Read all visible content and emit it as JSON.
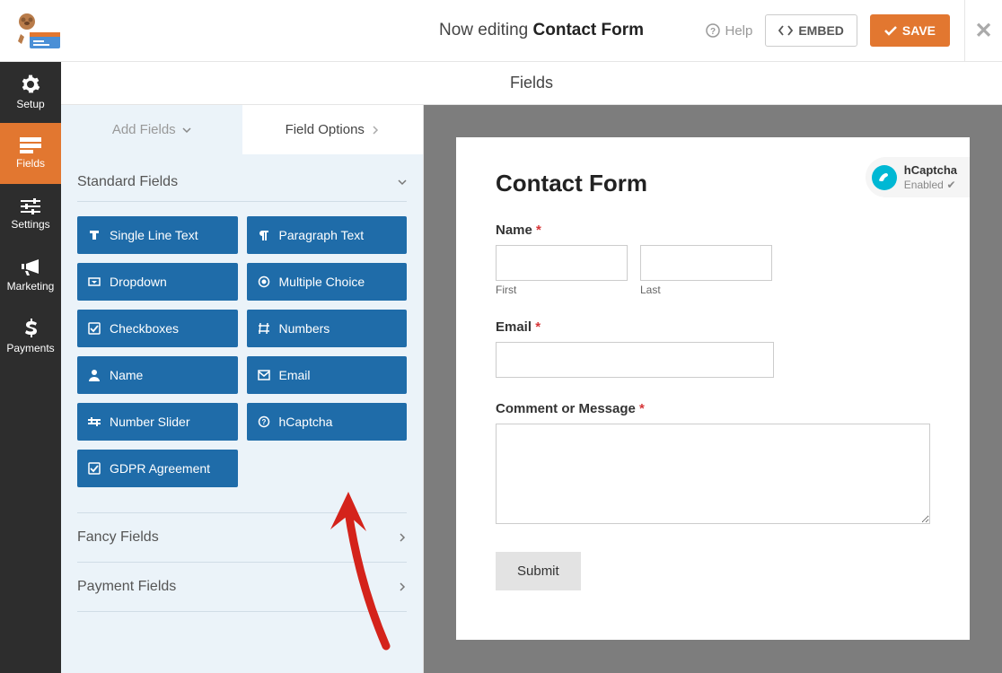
{
  "header": {
    "editing_prefix": "Now editing ",
    "editing_title": "Contact Form",
    "help": "Help",
    "embed": "EMBED",
    "save": "SAVE"
  },
  "sidenav": {
    "items": [
      {
        "label": "Setup"
      },
      {
        "label": "Fields"
      },
      {
        "label": "Settings"
      },
      {
        "label": "Marketing"
      },
      {
        "label": "Payments"
      }
    ]
  },
  "section_header": "Fields",
  "tabs": {
    "add": "Add Fields",
    "options": "Field Options"
  },
  "standard": {
    "title": "Standard Fields",
    "fields": [
      "Single Line Text",
      "Paragraph Text",
      "Dropdown",
      "Multiple Choice",
      "Checkboxes",
      "Numbers",
      "Name",
      "Email",
      "Number Slider",
      "hCaptcha",
      "GDPR Agreement"
    ]
  },
  "collapsed": {
    "fancy": "Fancy Fields",
    "payment": "Payment Fields"
  },
  "form": {
    "title": "Contact Form",
    "captcha_name": "hCaptcha",
    "captcha_status": "Enabled",
    "name_label": "Name",
    "first": "First",
    "last": "Last",
    "email_label": "Email",
    "message_label": "Comment or Message",
    "submit": "Submit"
  }
}
